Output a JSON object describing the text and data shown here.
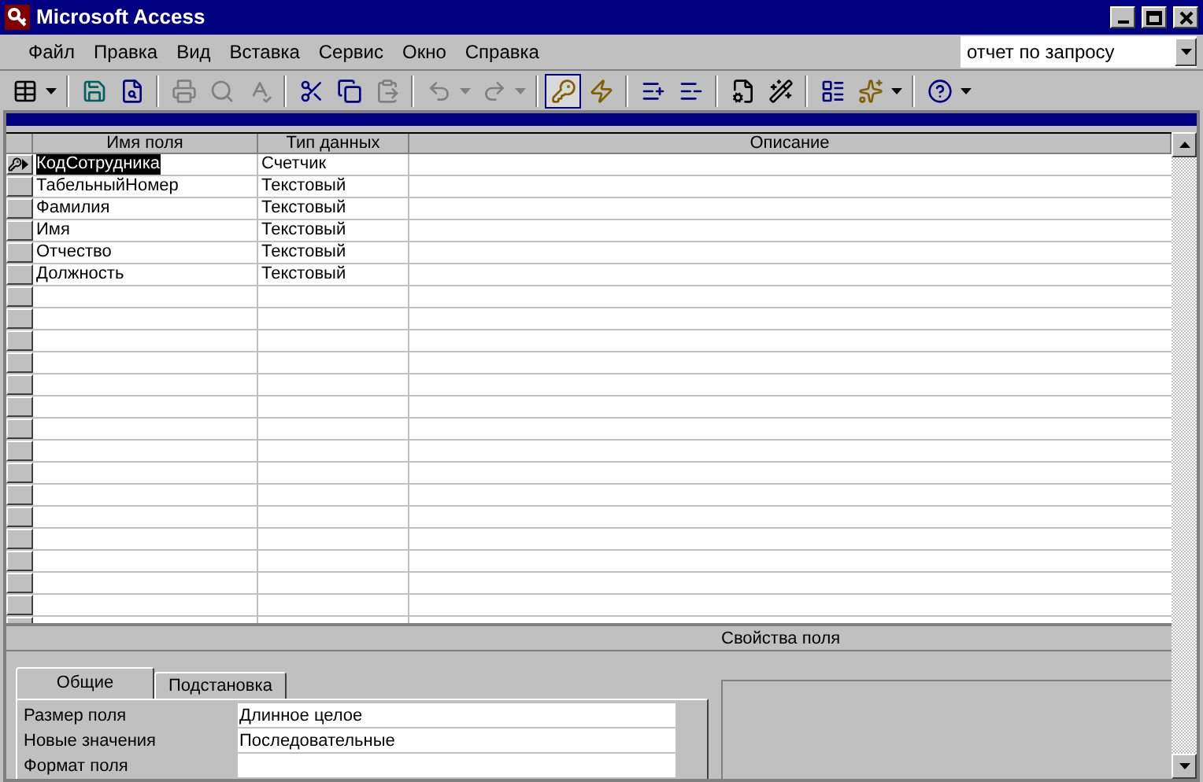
{
  "window": {
    "title": "Microsoft Access"
  },
  "menu": [
    "Файл",
    "Правка",
    "Вид",
    "Вставка",
    "Сервис",
    "Окно",
    "Справка"
  ],
  "combo": {
    "value": "отчет по запросу"
  },
  "toolbar": [
    {
      "kind": "button",
      "dropdown": true,
      "disabled": false,
      "pressed": false
    },
    {
      "kind": "separator"
    },
    {
      "kind": "button",
      "dropdown": false,
      "disabled": false,
      "pressed": false
    },
    {
      "kind": "button",
      "dropdown": false,
      "disabled": false,
      "pressed": false
    },
    {
      "kind": "separator"
    },
    {
      "kind": "button",
      "dropdown": false,
      "disabled": true,
      "pressed": false
    },
    {
      "kind": "button",
      "dropdown": false,
      "disabled": true,
      "pressed": false
    },
    {
      "kind": "button",
      "dropdown": false,
      "disabled": true,
      "pressed": false
    },
    {
      "kind": "separator"
    },
    {
      "kind": "button",
      "dropdown": false,
      "disabled": false,
      "pressed": false
    },
    {
      "kind": "button",
      "dropdown": false,
      "disabled": false,
      "pressed": false
    },
    {
      "kind": "button",
      "dropdown": false,
      "disabled": true,
      "pressed": false
    },
    {
      "kind": "separator"
    },
    {
      "kind": "button",
      "dropdown": true,
      "disabled": true,
      "pressed": false
    },
    {
      "kind": "button",
      "dropdown": true,
      "disabled": true,
      "pressed": false
    },
    {
      "kind": "separator"
    },
    {
      "kind": "button",
      "dropdown": false,
      "disabled": false,
      "pressed": true
    },
    {
      "kind": "button",
      "dropdown": false,
      "disabled": false,
      "pressed": false
    },
    {
      "kind": "separator"
    },
    {
      "kind": "button",
      "dropdown": false,
      "disabled": false,
      "pressed": false
    },
    {
      "kind": "button",
      "dropdown": false,
      "disabled": false,
      "pressed": false
    },
    {
      "kind": "separator"
    },
    {
      "kind": "button",
      "dropdown": false,
      "disabled": false,
      "pressed": false
    },
    {
      "kind": "button",
      "dropdown": false,
      "disabled": false,
      "pressed": false
    },
    {
      "kind": "separator"
    },
    {
      "kind": "button",
      "dropdown": false,
      "disabled": false,
      "pressed": false
    },
    {
      "kind": "button",
      "dropdown": true,
      "disabled": false,
      "pressed": false
    },
    {
      "kind": "separator"
    },
    {
      "kind": "button",
      "dropdown": true,
      "disabled": false,
      "pressed": false
    }
  ],
  "table": {
    "columns": [
      "Имя поля",
      "Тип данных",
      "Описание"
    ],
    "rows": [
      {
        "name": "КодСотрудника",
        "type": "Счетчик",
        "primary_key": true,
        "current": true,
        "selected": true
      },
      {
        "name": "ТабельныйНомер",
        "type": "Текстовый",
        "primary_key": false,
        "current": false,
        "selected": false
      },
      {
        "name": "Фамилия",
        "type": "Текстовый",
        "primary_key": false,
        "current": false,
        "selected": false
      },
      {
        "name": "Имя",
        "type": "Текстовый",
        "primary_key": false,
        "current": false,
        "selected": false
      },
      {
        "name": "Отчество",
        "type": "Текстовый",
        "primary_key": false,
        "current": false,
        "selected": false
      },
      {
        "name": "Должность",
        "type": "Текстовый",
        "primary_key": false,
        "current": false,
        "selected": false
      }
    ]
  },
  "properties": {
    "title": "Свойства поля",
    "tabs": [
      {
        "label": "Общие",
        "selected": true
      },
      {
        "label": "Подстановка",
        "selected": false
      }
    ],
    "rows": [
      {
        "name": "Размер поля",
        "value": "Длинное целое"
      },
      {
        "name": "Новые значения",
        "value": "Последовательные"
      },
      {
        "name": "Формат поля",
        "value": ""
      }
    ]
  }
}
